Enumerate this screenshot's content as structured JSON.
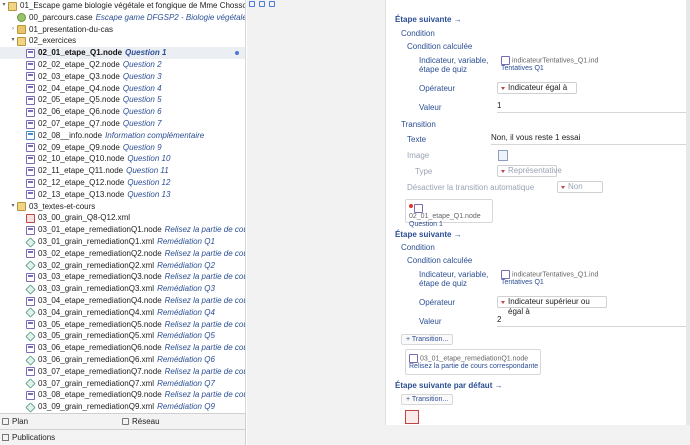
{
  "tree": {
    "rows": [
      {
        "indent": 0,
        "toggle": "▾",
        "icon": "folder-open",
        "name": "01_Escape game biologie végétale et fongique de Mme Chosson",
        "label": ""
      },
      {
        "indent": 1,
        "toggle": "",
        "icon": "case",
        "name": "00_parcours.case",
        "label": "Escape game DFGSP2 - Biologie végétale et f..."
      },
      {
        "indent": 1,
        "toggle": "›",
        "icon": "folder",
        "name": "01_presentation-du-cas",
        "label": ""
      },
      {
        "indent": 1,
        "toggle": "▾",
        "icon": "folder-open",
        "name": "02_exercices",
        "label": ""
      },
      {
        "indent": 2,
        "toggle": "",
        "icon": "node",
        "name": "02_01_etape_Q1.node",
        "label": "Question 1",
        "selected": true
      },
      {
        "indent": 2,
        "toggle": "",
        "icon": "node",
        "name": "02_02_etape_Q2.node",
        "label": "Question 2"
      },
      {
        "indent": 2,
        "toggle": "",
        "icon": "node",
        "name": "02_03_etape_Q3.node",
        "label": "Question 3"
      },
      {
        "indent": 2,
        "toggle": "",
        "icon": "node",
        "name": "02_04_etape_Q4.node",
        "label": "Question 4"
      },
      {
        "indent": 2,
        "toggle": "",
        "icon": "node",
        "name": "02_05_etape_Q5.node",
        "label": "Question 5"
      },
      {
        "indent": 2,
        "toggle": "",
        "icon": "node",
        "name": "02_06_etape_Q6.node",
        "label": "Question 6"
      },
      {
        "indent": 2,
        "toggle": "",
        "icon": "node",
        "name": "02_07_etape_Q7.node",
        "label": "Question 7"
      },
      {
        "indent": 2,
        "toggle": "",
        "icon": "node info",
        "name": "02_08__info.node",
        "label": "Information complémentaire"
      },
      {
        "indent": 2,
        "toggle": "",
        "icon": "node",
        "name": "02_09_etape_Q9.node",
        "label": "Question 9"
      },
      {
        "indent": 2,
        "toggle": "",
        "icon": "node",
        "name": "02_10_etape_Q10.node",
        "label": "Question 10"
      },
      {
        "indent": 2,
        "toggle": "",
        "icon": "node",
        "name": "02_11_etape_Q11.node",
        "label": "Question 11"
      },
      {
        "indent": 2,
        "toggle": "",
        "icon": "node",
        "name": "02_12_etape_Q12.node",
        "label": "Question 12"
      },
      {
        "indent": 2,
        "toggle": "",
        "icon": "node",
        "name": "02_13_etape_Q13.node",
        "label": "Question 13"
      },
      {
        "indent": 1,
        "toggle": "▾",
        "icon": "folder-open",
        "name": "03_textes-et-cours",
        "label": ""
      },
      {
        "indent": 2,
        "toggle": "",
        "icon": "xml-red",
        "name": "03_00_grain_Q8-Q12.xml",
        "label": ""
      },
      {
        "indent": 2,
        "toggle": "",
        "icon": "node",
        "name": "03_01_etape_remediationQ1.node",
        "label": "Relisez la partie de cours ..."
      },
      {
        "indent": 2,
        "toggle": "",
        "icon": "xml",
        "name": "03_01_grain_remediationQ1.xml",
        "label": "Remédiation Q1"
      },
      {
        "indent": 2,
        "toggle": "",
        "icon": "node",
        "name": "03_02_etape_remediationQ2.node",
        "label": "Relisez la partie de cours ..."
      },
      {
        "indent": 2,
        "toggle": "",
        "icon": "xml",
        "name": "03_02_grain_remediationQ2.xml",
        "label": "Remédiation Q2"
      },
      {
        "indent": 2,
        "toggle": "",
        "icon": "node",
        "name": "03_03_etape_remediationQ3.node",
        "label": "Relisez la partie de cours ..."
      },
      {
        "indent": 2,
        "toggle": "",
        "icon": "xml",
        "name": "03_03_grain_remediationQ3.xml",
        "label": "Remédiation Q3"
      },
      {
        "indent": 2,
        "toggle": "",
        "icon": "node",
        "name": "03_04_etape_remediationQ4.node",
        "label": "Relisez la partie de cours ..."
      },
      {
        "indent": 2,
        "toggle": "",
        "icon": "xml",
        "name": "03_04_grain_remediationQ4.xml",
        "label": "Remédiation Q4"
      },
      {
        "indent": 2,
        "toggle": "",
        "icon": "node",
        "name": "03_05_etape_remediationQ5.node",
        "label": "Relisez la partie de cours ..."
      },
      {
        "indent": 2,
        "toggle": "",
        "icon": "xml",
        "name": "03_05_grain_remediationQ5.xml",
        "label": "Remédiation Q5"
      },
      {
        "indent": 2,
        "toggle": "",
        "icon": "node",
        "name": "03_06_etape_remediationQ6.node",
        "label": "Relisez la partie de cours ..."
      },
      {
        "indent": 2,
        "toggle": "",
        "icon": "xml",
        "name": "03_06_grain_remediationQ6.xml",
        "label": "Remédiation Q6"
      },
      {
        "indent": 2,
        "toggle": "",
        "icon": "node",
        "name": "03_07_etape_remediationQ7.node",
        "label": "Relisez la partie de cours ..."
      },
      {
        "indent": 2,
        "toggle": "",
        "icon": "xml",
        "name": "03_07_grain_remediationQ7.xml",
        "label": "Remédiation Q7"
      },
      {
        "indent": 2,
        "toggle": "",
        "icon": "node",
        "name": "03_08_etape_remediationQ9.node",
        "label": "Relisez la partie de cours ..."
      },
      {
        "indent": 2,
        "toggle": "",
        "icon": "xml",
        "name": "03_09_grain_remediationQ9.xml",
        "label": "Remédiation Q9"
      }
    ]
  },
  "bottom": {
    "plan": "Plan",
    "reseau": "Réseau",
    "publications": "Publications"
  },
  "editor": {
    "step1": {
      "title": "Étape suivante",
      "condition": "Condition",
      "computed": "Condition calculée",
      "indicator_label": "Indicateur, variable, étape de quiz",
      "indicator_ref_id": "indicateurTentatives_Q1.ind",
      "indicator_ref_title": "Tentatives Q1",
      "operator_label": "Opérateur",
      "operator_value": "Indicateur égal à",
      "value_label": "Valeur",
      "value": "1",
      "transition": "Transition",
      "text_label": "Texte",
      "text_value": "Non, il vous reste 1 essai",
      "image_label": "Image",
      "type_label": "Type",
      "type_value": "Représentative",
      "disable_label": "Désactiver la transition automatique",
      "disable_value": "Non",
      "target_id": "02_01_etape_Q1.node",
      "target_title": "Question 1"
    },
    "step2": {
      "title": "Étape suivante",
      "condition": "Condition",
      "computed": "Condition calculée",
      "indicator_label": "Indicateur, variable, étape de quiz",
      "indicator_ref_id": "indicateurTentatives_Q1.ind",
      "indicator_ref_title": "Tentatives Q1",
      "operator_label": "Opérateur",
      "operator_value": "Indicateur supérieur ou égal à",
      "value_label": "Valeur",
      "value": "2",
      "transition_btn": "+ Transition...",
      "target_id": "03_01_etape_remediationQ1.node",
      "target_title": "Relisez la partie de cours correspondante"
    },
    "default": {
      "title": "Étape suivante par défaut",
      "transition_btn": "+ Transition..."
    }
  }
}
